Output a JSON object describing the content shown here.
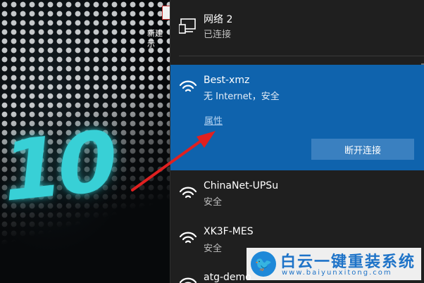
{
  "desktop": {
    "wallpaper_text": "10",
    "file_label_line1": "新建",
    "file_label_line2": "示"
  },
  "flyout": {
    "wired": {
      "name": "网络 2",
      "status": "已连接",
      "icon": "ethernet-icon"
    },
    "active": {
      "name": "Best-xmz",
      "status": "无 Internet，安全",
      "properties_label": "属性",
      "disconnect_label": "断开连接",
      "icon": "wifi-icon"
    },
    "networks": [
      {
        "name": "ChinaNet-UPSu",
        "status": "安全",
        "icon": "wifi-icon"
      },
      {
        "name": "XK3F-MES",
        "status": "安全",
        "icon": "wifi-icon"
      },
      {
        "name": "atg-demo",
        "status": "",
        "icon": "wifi-icon"
      }
    ]
  },
  "annotation": {
    "arrow_color": "#e02020"
  },
  "watermark": {
    "title": "白云一键重装系统",
    "url": "www.baiyunxitong.com",
    "logo_icon": "bird-icon",
    "color": "#1e73c8"
  },
  "colors": {
    "flyout_bg": "#1f1f1f",
    "active_bg": "#0f63ad",
    "button_bg": "#3a80c0",
    "link": "#b3d2f0"
  }
}
